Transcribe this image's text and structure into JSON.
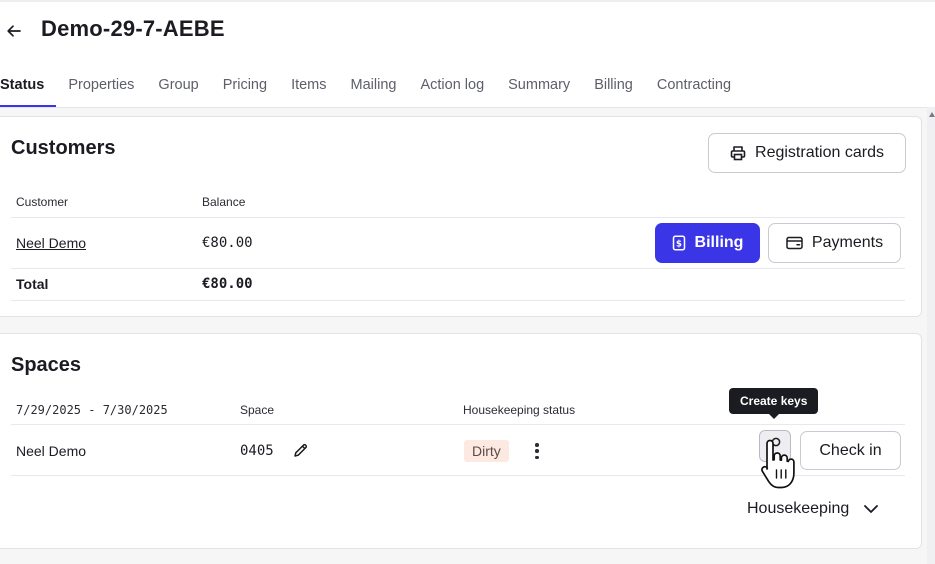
{
  "page": {
    "title": "Demo-29-7-AEBE"
  },
  "tabs": [
    {
      "label": "Status",
      "active": true
    },
    {
      "label": "Properties"
    },
    {
      "label": "Group"
    },
    {
      "label": "Pricing"
    },
    {
      "label": "Items"
    },
    {
      "label": "Mailing"
    },
    {
      "label": "Action log"
    },
    {
      "label": "Summary"
    },
    {
      "label": "Billing"
    },
    {
      "label": "Contracting"
    }
  ],
  "customers": {
    "title": "Customers",
    "registration_cards_label": "Registration cards",
    "headers": {
      "customer": "Customer",
      "balance": "Balance"
    },
    "rows": [
      {
        "customer": "Neel Demo",
        "balance": "€80.00",
        "billing_label": "Billing",
        "payments_label": "Payments"
      }
    ],
    "total": {
      "label": "Total",
      "balance": "€80.00"
    }
  },
  "spaces": {
    "title": "Spaces",
    "headers": {
      "dates": "7/29/2025 - 7/30/2025",
      "space": "Space",
      "housekeeping": "Housekeeping status"
    },
    "rows": [
      {
        "guest": "Neel Demo",
        "space": "0405",
        "housekeeping_status": "Dirty",
        "check_in_label": "Check in"
      }
    ],
    "tooltip": "Create keys",
    "housekeeping_dropdown": "Housekeeping"
  },
  "colors": {
    "primary": "#3b35e8",
    "dirty_badge_bg": "#fce9e2",
    "tooltip_bg": "#1b1b22"
  },
  "icons": [
    "back-arrow-icon",
    "printer-icon",
    "billing-doc-icon",
    "wallet-icon",
    "pencil-icon",
    "more-vertical-icon",
    "key-icon",
    "chevron-down-icon",
    "hand-cursor-icon"
  ]
}
